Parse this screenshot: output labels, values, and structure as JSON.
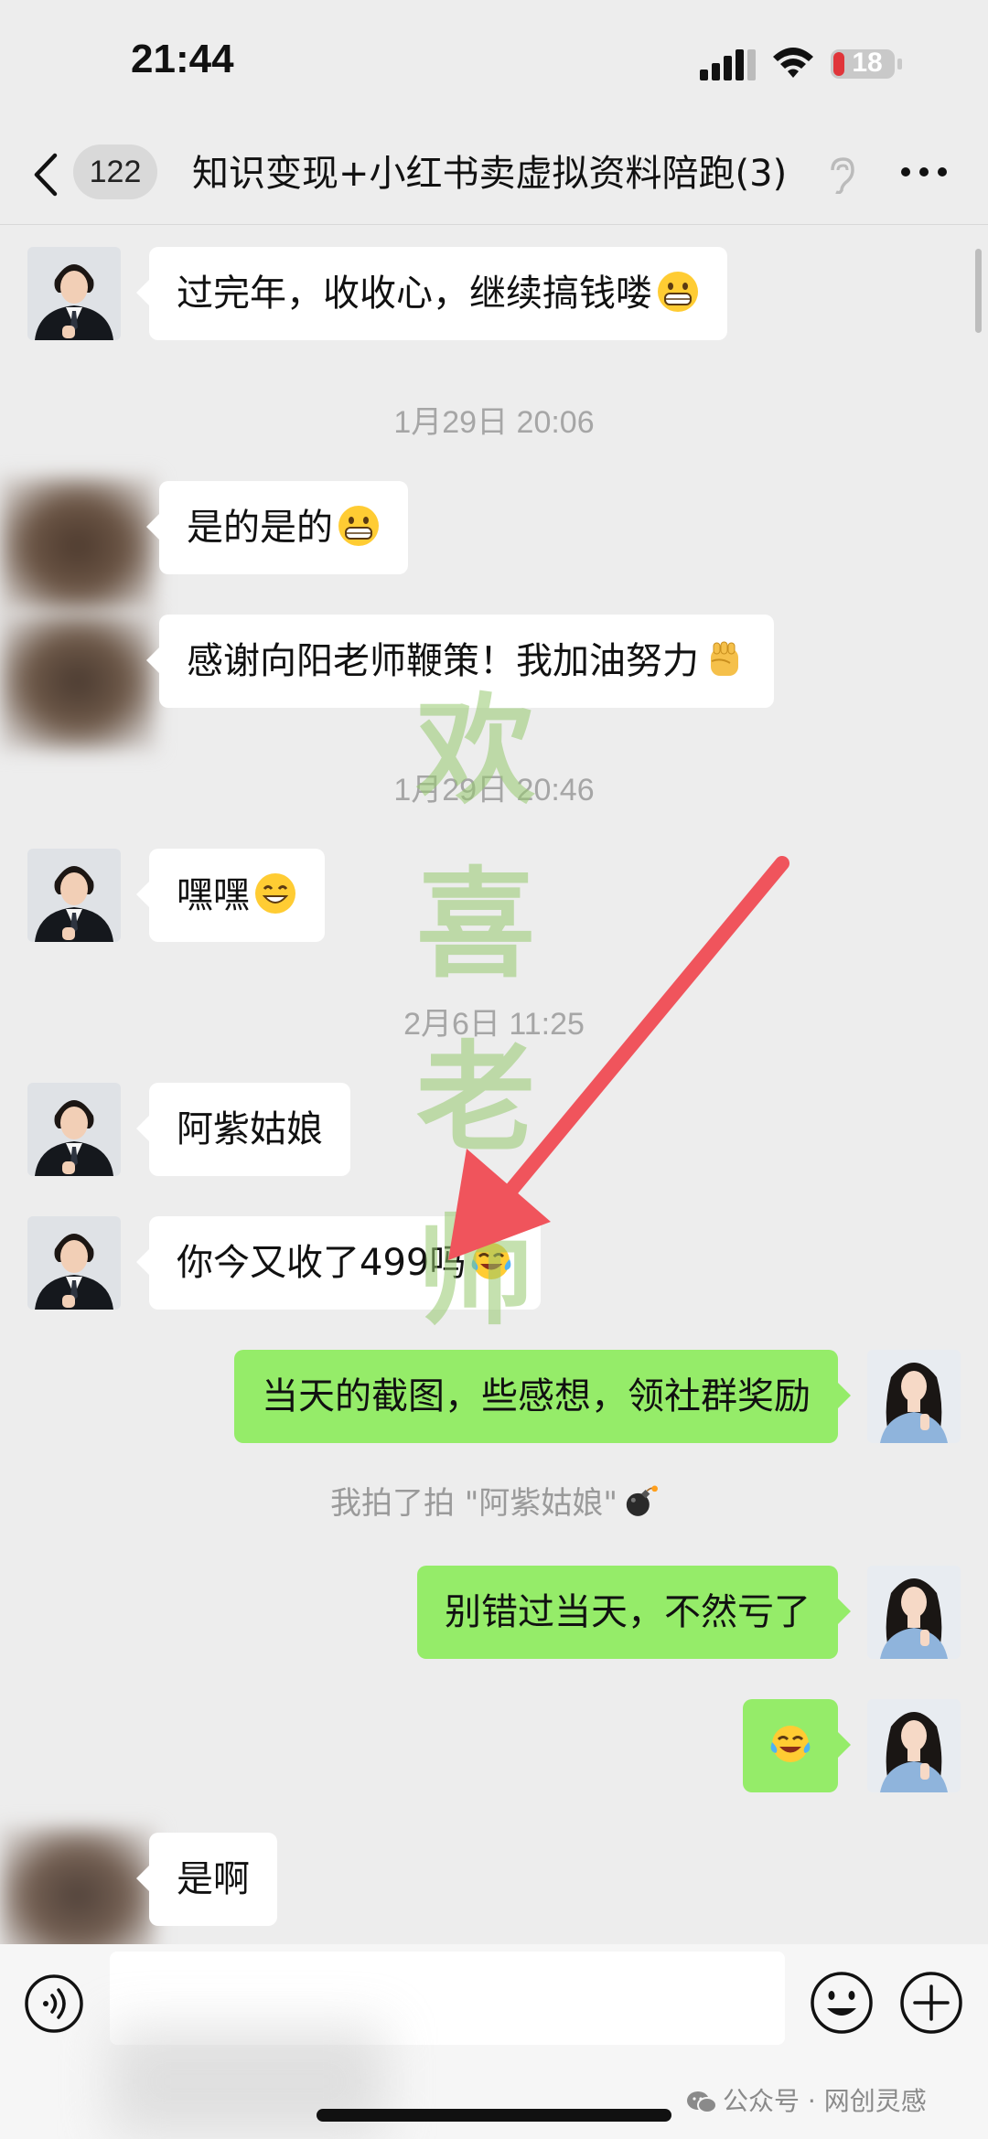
{
  "status_bar": {
    "time": "21:44",
    "battery": "18"
  },
  "nav": {
    "unread_count": "122",
    "title": "知识变现+小红书卖虚拟资料陪跑",
    "member_count": "(3)"
  },
  "messages": [
    {
      "type": "in",
      "text": "过完年，收收心，继续搞钱喽",
      "emoji": "grin-emoji"
    },
    {
      "type": "time",
      "text": "1月29日 20:06"
    },
    {
      "type": "in",
      "text": "是的是的",
      "emoji": "grin-emoji"
    },
    {
      "type": "in",
      "text": "感谢向阳老师鞭策！我加油努力",
      "emoji": "raised-fist-emoji"
    },
    {
      "type": "time",
      "text": "1月29日 20:46"
    },
    {
      "type": "in",
      "text": "嘿嘿",
      "emoji": "smile-emoji"
    },
    {
      "type": "time",
      "text": "2月6日 11:25"
    },
    {
      "type": "in",
      "text": "阿紫姑娘"
    },
    {
      "type": "in",
      "text": "你今又收了499吗",
      "emoji": "tears-of-joy-emoji"
    },
    {
      "type": "out",
      "text": "当天的截图，些感想，领社群奖励"
    },
    {
      "type": "system",
      "text": "我拍了拍 \"阿紫姑娘\"",
      "emoji": "bomb-emoji"
    },
    {
      "type": "out",
      "text": "别错过当天，不然亏了"
    },
    {
      "type": "out",
      "text": "",
      "emoji": "tears-of-joy-emoji"
    },
    {
      "type": "in",
      "text": "是啊"
    }
  ],
  "watermark": {
    "chars": [
      "欢",
      "喜",
      "老",
      "师"
    ]
  },
  "input": {
    "placeholder": ""
  },
  "footer": {
    "wechat_watermark": "公众号 · 网创灵感"
  },
  "colors": {
    "background": "#ededed",
    "outgoing_bubble": "#95ec69",
    "incoming_bubble": "#ffffff",
    "arrow": "#f0545c",
    "watermark": "#96c86e"
  }
}
